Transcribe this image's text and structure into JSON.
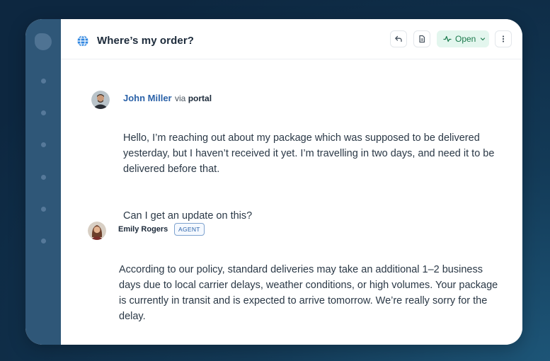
{
  "header": {
    "title": "Where’s my order?",
    "status_label": "Open"
  },
  "colors": {
    "background": "#133a57",
    "sidebar": "#2f5778",
    "status_bg": "#e3f6ee",
    "status_text": "#1b7a4c",
    "link_name": "#2b62a8"
  },
  "icons": {
    "title": "globe-icon",
    "reply": "reply-arrow-icon",
    "notes": "document-icon",
    "status": "activity-pulse-icon",
    "more": "more-vertical-icon"
  },
  "messages": [
    {
      "author": "John Miller",
      "via_prefix": "via",
      "via_channel": "portal",
      "paragraphs": [
        "Hello, I’m reaching out about my package which was supposed to be delivered yesterday, but I haven’t received it yet. I’m travelling in two days, and need it to be delivered before that.",
        "Can I get an update on this?"
      ]
    },
    {
      "author": "Emily Rogers",
      "role_badge": "AGENT",
      "paragraphs": [
        "According to our policy, standard deliveries may take an additional 1–2 business days due to local carrier delays, weather conditions, or high volumes. Your package is currently in transit and is expected to arrive tomorrow. We’re really sorry for the delay."
      ]
    }
  ]
}
